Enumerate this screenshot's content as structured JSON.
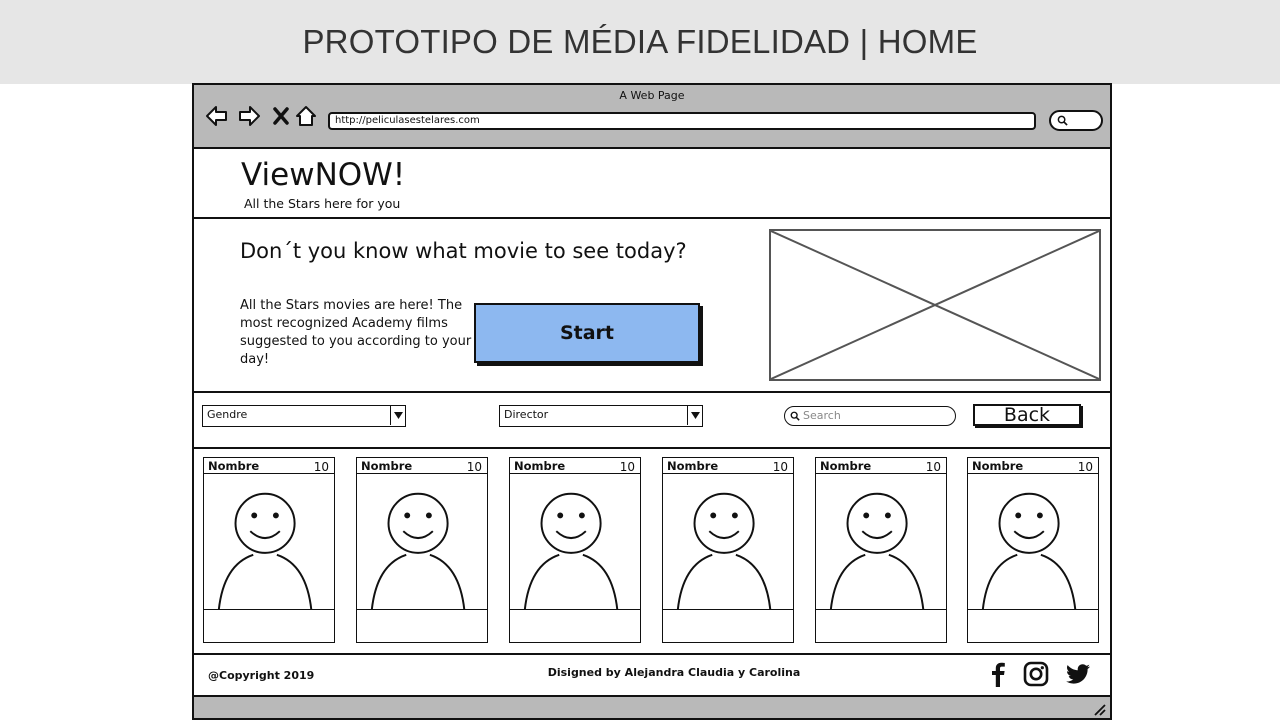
{
  "slide": {
    "title": "PROTOTIPO DE MÉDIA FIDELIDAD | HOME"
  },
  "browser": {
    "window_title": "A Web Page",
    "url": "http://peliculasestelares.com",
    "icons": [
      "back-arrow-icon",
      "forward-arrow-icon",
      "close-x-icon",
      "home-icon",
      "search-icon"
    ]
  },
  "header": {
    "brand": "ViewNOW!",
    "tagline": "All the Stars here for you"
  },
  "hero": {
    "question": "Don´t you know what movie to see today?",
    "description": "All the Stars movies are here! The most recognized Academy films suggested to you according to your day!",
    "start_label": "Start",
    "image_placeholder": "image-placeholder"
  },
  "filters": {
    "genre_value": "Gendre",
    "director_value": "Director",
    "search_placeholder": "Search",
    "back_label": "Back"
  },
  "cards": [
    {
      "name": "Nombre",
      "rating": "10"
    },
    {
      "name": "Nombre",
      "rating": "10"
    },
    {
      "name": "Nombre",
      "rating": "10"
    },
    {
      "name": "Nombre",
      "rating": "10"
    },
    {
      "name": "Nombre",
      "rating": "10"
    },
    {
      "name": "Nombre",
      "rating": "10"
    }
  ],
  "footer": {
    "copyright": "@Copyright 2019",
    "designed_by": "Disigned by Alejandra Claudia y Carolina",
    "social": [
      "facebook-icon",
      "instagram-icon",
      "twitter-icon"
    ]
  },
  "colors": {
    "start_button": "#8db8f0",
    "chrome": "#b9b9b9",
    "slide_header": "#e6e6e6"
  }
}
